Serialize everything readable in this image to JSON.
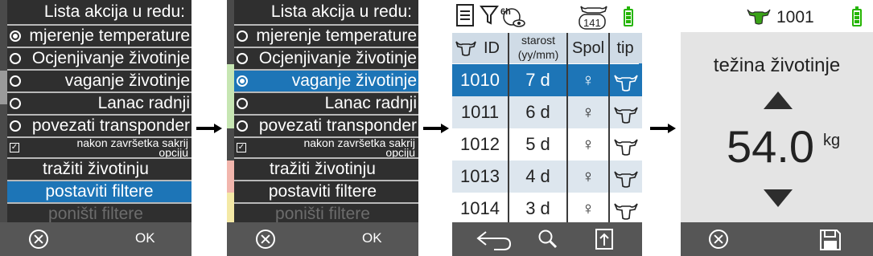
{
  "menu_screen_1": {
    "title": "Lista akcija u redu:",
    "items": [
      {
        "label": "mjerenje temperature"
      },
      {
        "label": "Ocjenjivanje životinje"
      },
      {
        "label": "vaganje životinje"
      },
      {
        "label": "Lanac radnji"
      },
      {
        "label": "povezati transponder"
      }
    ],
    "checkbox_line1": "nakon završetka sakrij",
    "checkbox_line2": "opciju",
    "search_label": "tražiti životinju",
    "filter_label": "postaviti filtere",
    "reset_filter_label": "poništi filtere",
    "ok_label": "OK"
  },
  "menu_screen_2": {
    "title": "Lista akcija u redu:",
    "items": [
      {
        "label": "mjerenje temperature"
      },
      {
        "label": "Ocjenjivanje životinje"
      },
      {
        "label": "vaganje životinje"
      },
      {
        "label": "Lanac radnji"
      },
      {
        "label": "povezati transponder"
      }
    ],
    "checkbox_line1": "nakon završetka sakrij",
    "checkbox_line2": "opciju",
    "search_label": "tražiti životinju",
    "filter_label": "postaviti filtere",
    "reset_filter_label": "poništi filtere",
    "ok_label": "OK"
  },
  "table_screen": {
    "filter_badge": "6h",
    "animal_count": "141",
    "headers": {
      "id": "ID",
      "age_line1": "starost",
      "age_line2": "(yy/mm)",
      "sex": "Spol",
      "type": "tip"
    },
    "rows": [
      {
        "id": "1010",
        "age": "7 d",
        "sex": "♀"
      },
      {
        "id": "1011",
        "age": "6 d",
        "sex": "♀"
      },
      {
        "id": "1012",
        "age": "5 d",
        "sex": "♀"
      },
      {
        "id": "1013",
        "age": "4 d",
        "sex": "♀"
      },
      {
        "id": "1014",
        "age": "3 d",
        "sex": "♀"
      }
    ],
    "selected_row": 0
  },
  "weight_screen": {
    "animal_id": "1001",
    "label": "težina životinje",
    "value": "54.0",
    "unit": "kg"
  },
  "colors": {
    "accent": "#1d75b7",
    "battery": "#25b500",
    "menu_bg": "#2f2f2f",
    "bottom_bar": "#565656"
  }
}
